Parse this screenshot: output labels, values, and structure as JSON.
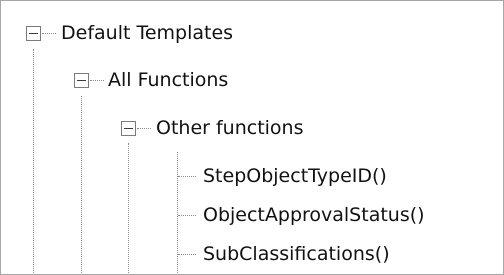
{
  "tree": {
    "root": {
      "label": "Default Templates",
      "expanded": true,
      "children": [
        {
          "label": "All Functions",
          "expanded": true,
          "children": [
            {
              "label": "Other functions",
              "expanded": true,
              "children": [
                {
                  "label": "StepObjectTypeID()"
                },
                {
                  "label": "ObjectApprovalStatus()"
                },
                {
                  "label": "SubClassifications()"
                }
              ]
            }
          ]
        }
      ]
    }
  }
}
